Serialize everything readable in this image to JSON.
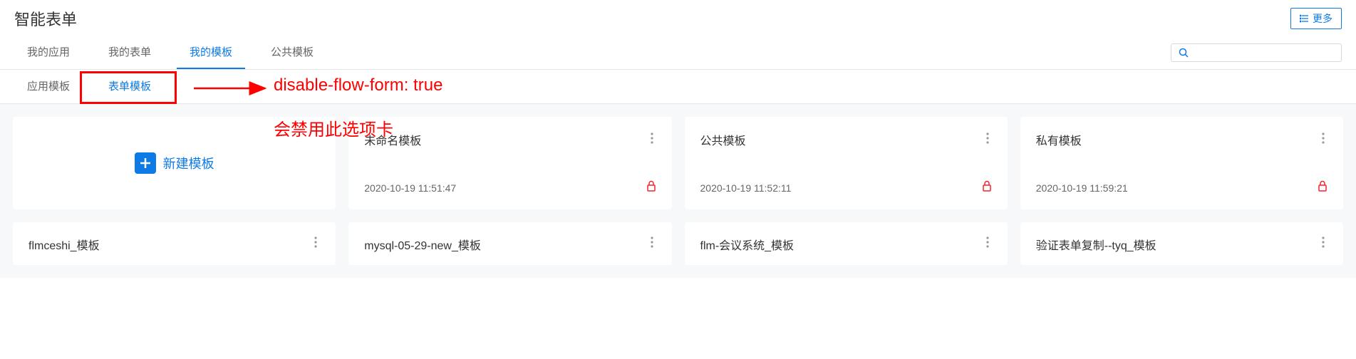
{
  "header": {
    "title": "智能表单",
    "more_label": "更多"
  },
  "tabs": {
    "items": [
      {
        "label": "我的应用",
        "active": false
      },
      {
        "label": "我的表单",
        "active": false
      },
      {
        "label": "我的模板",
        "active": true
      },
      {
        "label": "公共模板",
        "active": false
      }
    ]
  },
  "subtabs": {
    "items": [
      {
        "label": "应用模板",
        "active": false
      },
      {
        "label": "表单模板",
        "active": true
      }
    ]
  },
  "annotations": {
    "line1": "disable-flow-form: true",
    "line2": "会禁用此选项卡"
  },
  "new_template": {
    "label": "新建模板"
  },
  "cards_row1": [
    {
      "title": "未命名模板",
      "date": "2020-10-19 11:51:47",
      "locked": true
    },
    {
      "title": "公共模板",
      "date": "2020-10-19 11:52:11",
      "locked": true
    },
    {
      "title": "私有模板",
      "date": "2020-10-19 11:59:21",
      "locked": true
    }
  ],
  "cards_row2": [
    {
      "title": "flmceshi_模板"
    },
    {
      "title": "mysql-05-29-new_模板"
    },
    {
      "title": "flm-会议系统_模板"
    },
    {
      "title": "验证表单复制--tyq_模板"
    }
  ],
  "search": {
    "placeholder": ""
  }
}
